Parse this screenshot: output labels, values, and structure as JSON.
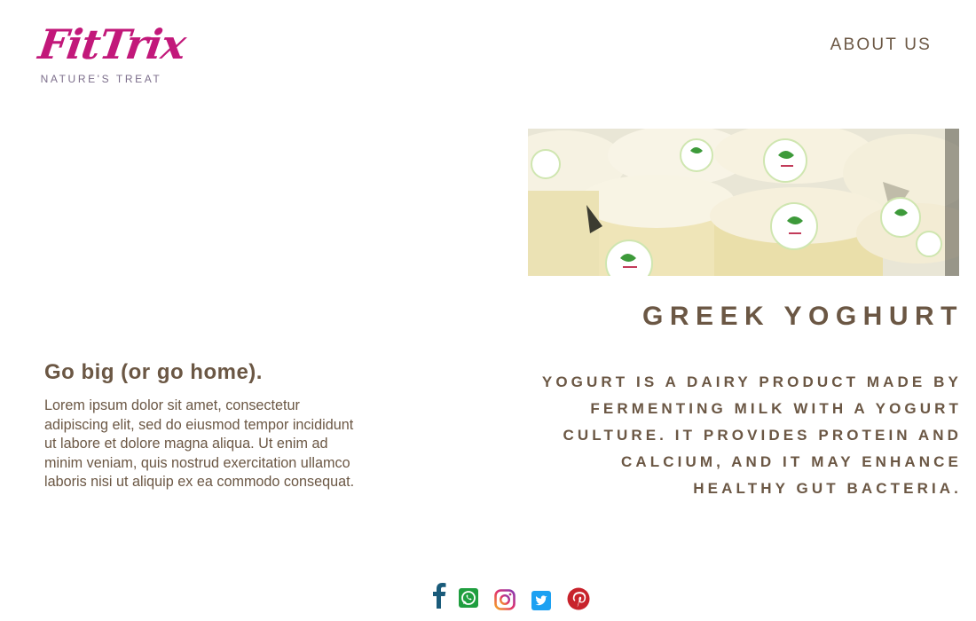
{
  "brand": {
    "logo_text": "FitTrix",
    "tagline": "NATURE'S TREAT",
    "logo_color": "#c2187a"
  },
  "nav": {
    "about_label": "ABOUT US"
  },
  "product": {
    "title": "GREEK YOGHURT",
    "description": "YOGURT IS A DAIRY PRODUCT MADE BY FERMENTING MILK WITH A YOGURT CULTURE. IT PROVIDES PROTEIN AND CALCIUM, AND IT MAY ENHANCE HEALTHY GUT BACTERIA."
  },
  "intro": {
    "heading": "Go big (or go home).",
    "body": "Lorem ipsum dolor sit amet, consectetur adipiscing elit, sed do eiusmod tempor incididunt ut labore et dolore magna aliqua. Ut enim ad minim veniam, quis nostrud exercitation ullamco laboris nisi ut aliquip ex ea commodo consequat."
  },
  "social": [
    {
      "name": "facebook-icon",
      "color": "#1a5b7a"
    },
    {
      "name": "whatsapp-icon",
      "color": "#1f9e3f"
    },
    {
      "name": "instagram-icon",
      "color": "#d6336c"
    },
    {
      "name": "twitter-icon",
      "color": "#1da1f2"
    },
    {
      "name": "pinterest-icon",
      "color": "#c8232c"
    }
  ],
  "colors": {
    "text": "#6b5744",
    "background": "#ffffff"
  }
}
